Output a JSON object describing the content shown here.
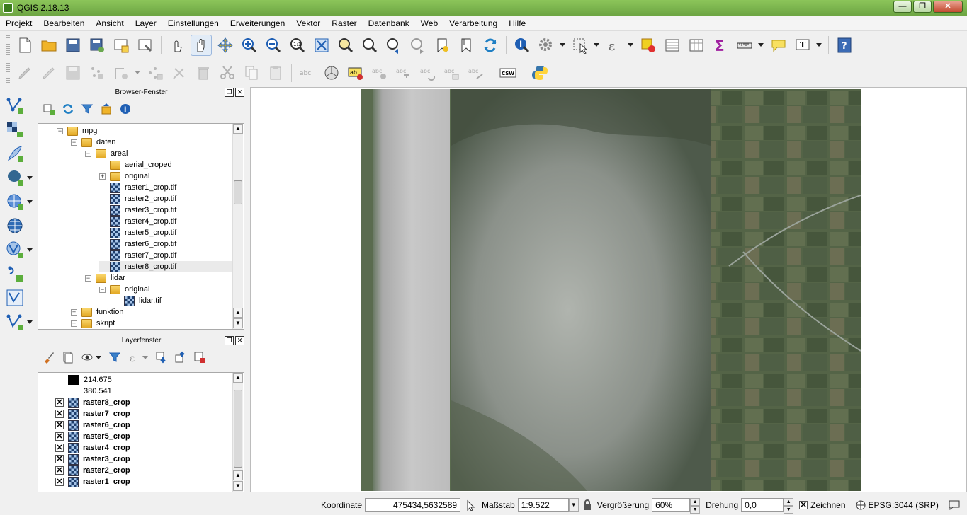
{
  "window": {
    "title": "QGIS 2.18.13",
    "minimize": "—",
    "maximize": "❐",
    "close": "✕"
  },
  "menu": [
    "Projekt",
    "Bearbeiten",
    "Ansicht",
    "Layer",
    "Einstellungen",
    "Erweiterungen",
    "Vektor",
    "Raster",
    "Datenbank",
    "Web",
    "Verarbeitung",
    "Hilfe"
  ],
  "toolbar2": {
    "csw_label": "CSW"
  },
  "browser_panel": {
    "title": "Browser-Fenster",
    "tree": [
      {
        "label": "mpg",
        "indent": 0,
        "type": "folder",
        "expander": "−"
      },
      {
        "label": "daten",
        "indent": 1,
        "type": "folder",
        "expander": "−"
      },
      {
        "label": "areal",
        "indent": 2,
        "type": "folder",
        "expander": "−"
      },
      {
        "label": "aerial_croped",
        "indent": 3,
        "type": "folder",
        "expander": ""
      },
      {
        "label": "original",
        "indent": 3,
        "type": "folder",
        "expander": "+"
      },
      {
        "label": "raster1_crop.tif",
        "indent": 3,
        "type": "raster"
      },
      {
        "label": "raster2_crop.tif",
        "indent": 3,
        "type": "raster"
      },
      {
        "label": "raster3_crop.tif",
        "indent": 3,
        "type": "raster"
      },
      {
        "label": "raster4_crop.tif",
        "indent": 3,
        "type": "raster"
      },
      {
        "label": "raster5_crop.tif",
        "indent": 3,
        "type": "raster"
      },
      {
        "label": "raster6_crop.tif",
        "indent": 3,
        "type": "raster"
      },
      {
        "label": "raster7_crop.tif",
        "indent": 3,
        "type": "raster"
      },
      {
        "label": "raster8_crop.tif",
        "indent": 3,
        "type": "raster",
        "selected": true
      },
      {
        "label": "lidar",
        "indent": 2,
        "type": "folder",
        "expander": "−"
      },
      {
        "label": "original",
        "indent": 3,
        "type": "folder",
        "expander": "−"
      },
      {
        "label": "lidar.tif",
        "indent": 4,
        "type": "raster"
      },
      {
        "label": "funktion",
        "indent": 1,
        "type": "folder",
        "expander": "+"
      },
      {
        "label": "skript",
        "indent": 1,
        "type": "folder",
        "expander": "+"
      }
    ]
  },
  "layer_panel": {
    "title": "Layerfenster",
    "legend": [
      {
        "label": "214.675",
        "swatch": "#000000"
      },
      {
        "label": "380.541",
        "swatch": "#ffffff"
      }
    ],
    "layers": [
      {
        "label": "raster8_crop",
        "checked": true
      },
      {
        "label": "raster7_crop",
        "checked": true
      },
      {
        "label": "raster6_crop",
        "checked": true
      },
      {
        "label": "raster5_crop",
        "checked": true
      },
      {
        "label": "raster4_crop",
        "checked": true
      },
      {
        "label": "raster3_crop",
        "checked": true
      },
      {
        "label": "raster2_crop",
        "checked": true
      },
      {
        "label": "raster1_crop",
        "checked": true,
        "underline": true
      }
    ]
  },
  "statusbar": {
    "coord_label": "Koordinate",
    "coord_value": "475434,5632589",
    "scale_label": "Maßstab",
    "scale_value": "1:9.522",
    "magnifier_label": "Vergrößerung",
    "magnifier_value": "60%",
    "rotation_label": "Drehung",
    "rotation_value": "0,0",
    "render_label": "Zeichnen",
    "render_checked": "✕",
    "crs_label": "EPSG:3044 (SRP)"
  },
  "colors": {
    "titlebar": "#7cb84c",
    "accent_blue": "#1f5fb4",
    "sigma": "#a020a0"
  }
}
